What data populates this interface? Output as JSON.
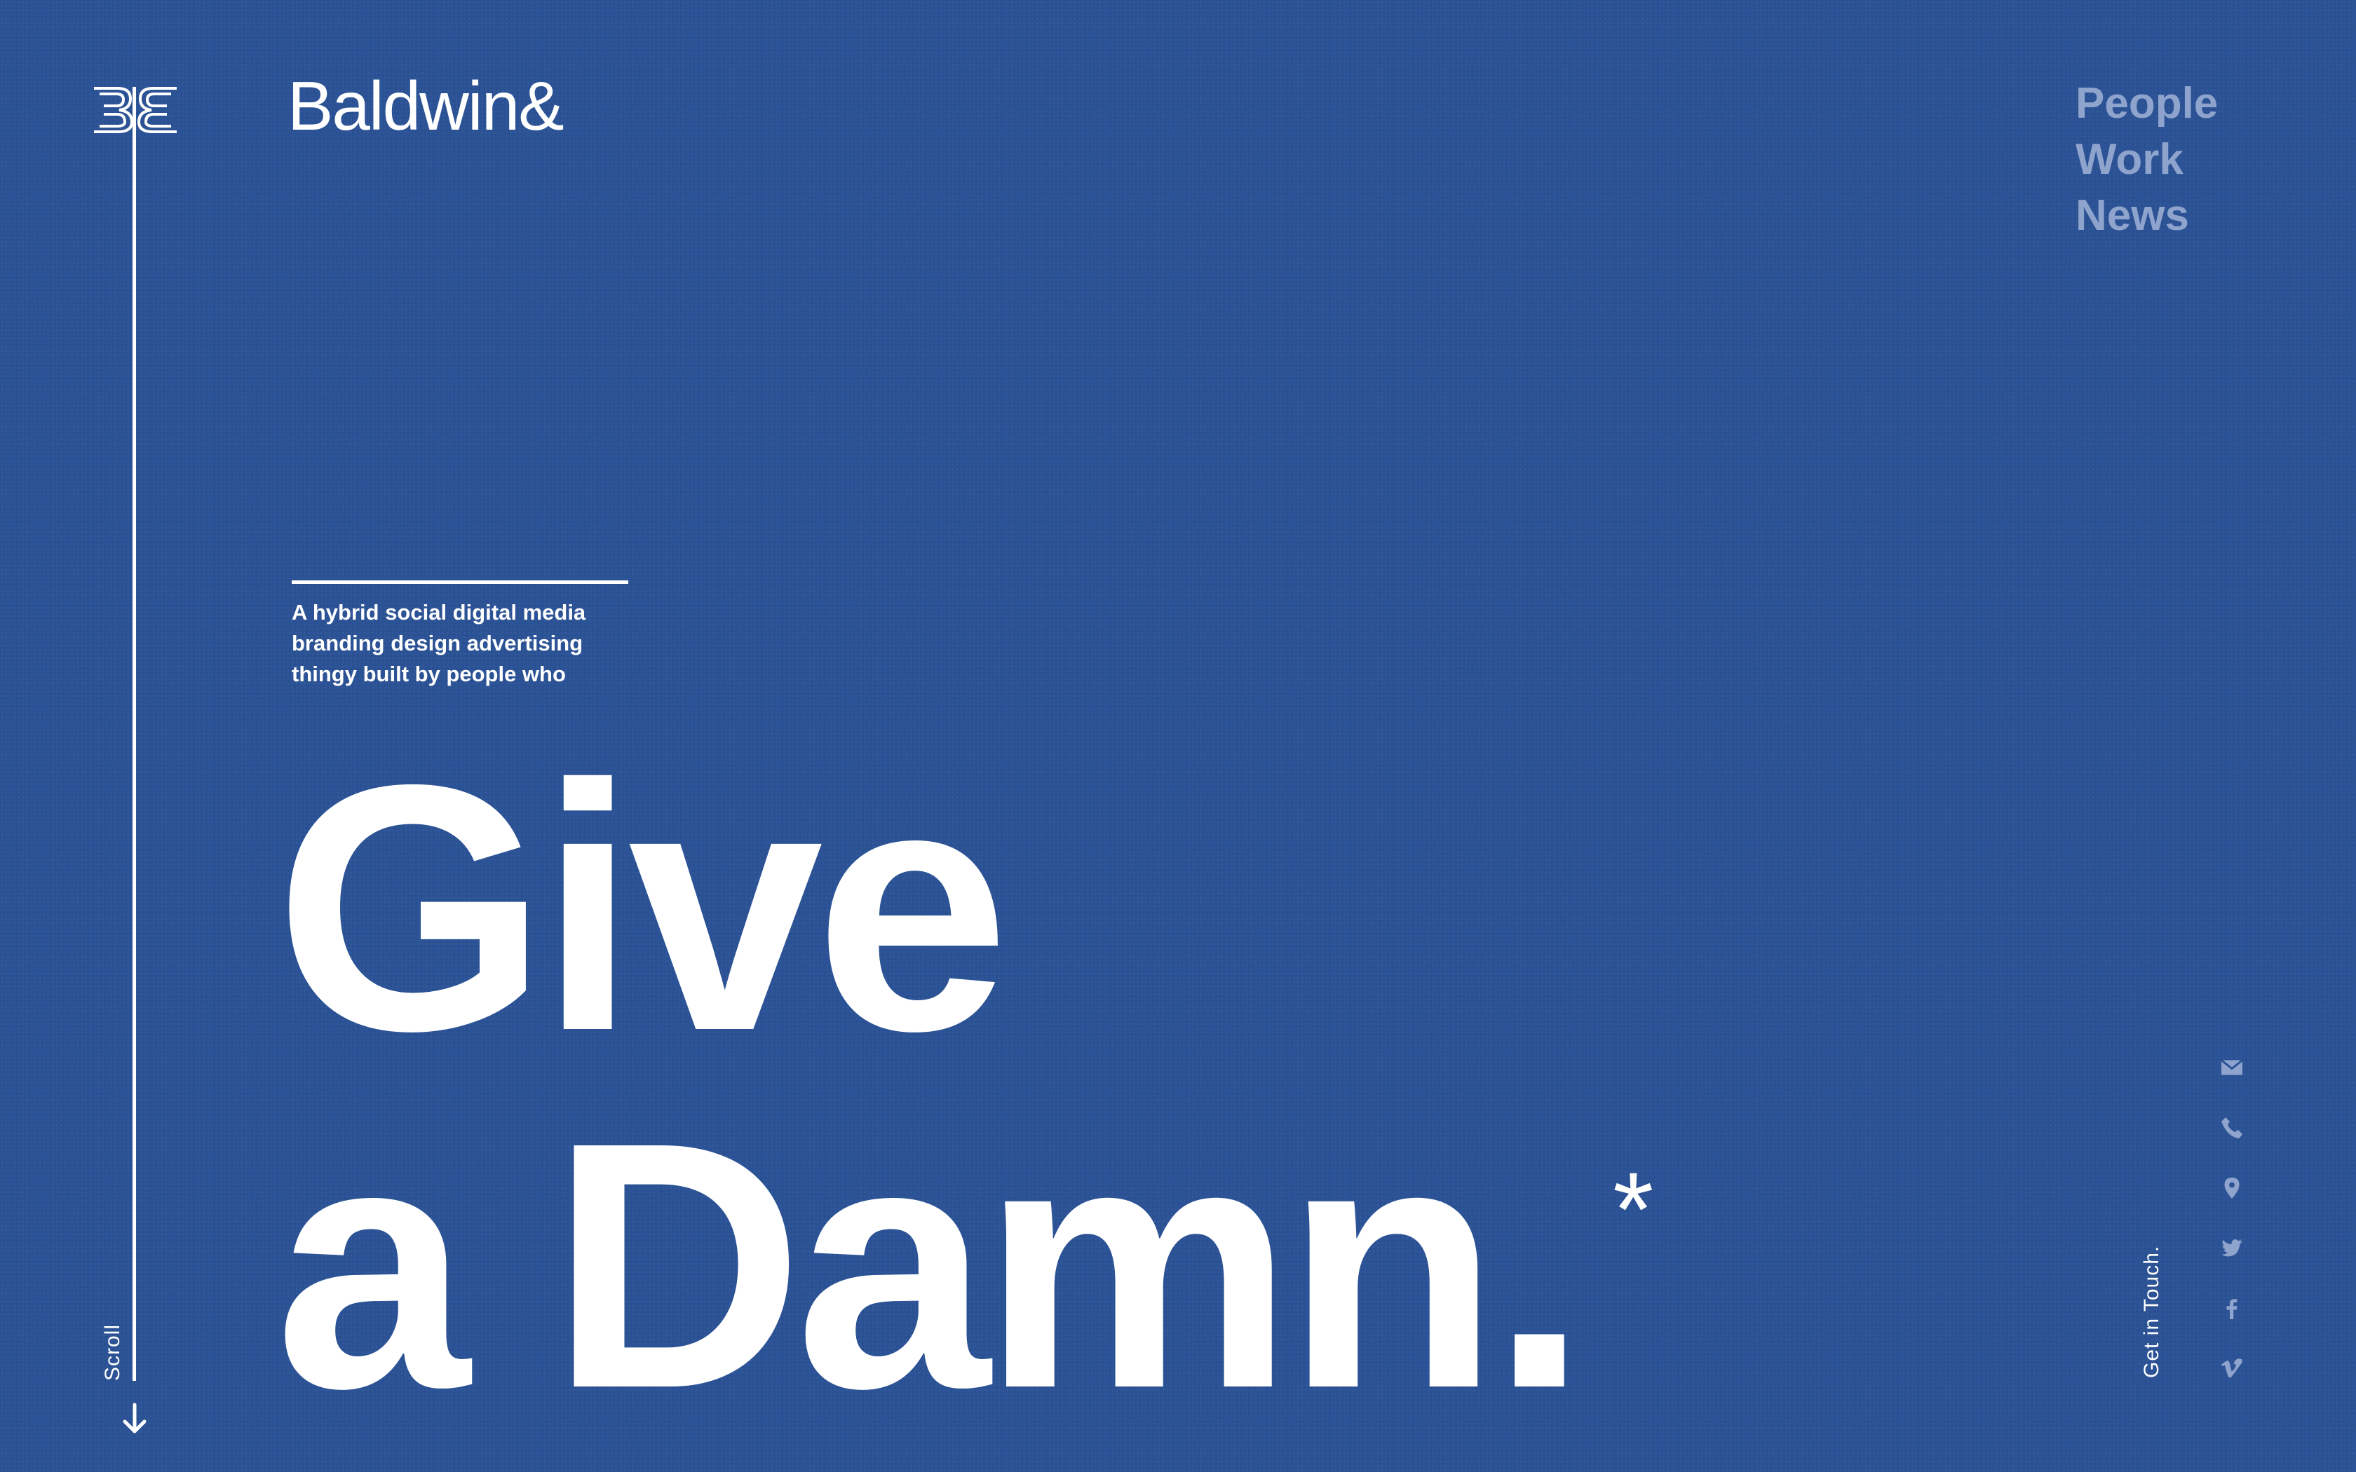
{
  "brand": {
    "monogram_icon": "bb-monogram-icon",
    "name": "Baldwin&"
  },
  "nav": {
    "items": [
      {
        "label": "People"
      },
      {
        "label": "Work"
      },
      {
        "label": "News"
      }
    ]
  },
  "intro": {
    "tagline_lines": [
      "A hybrid social digital media",
      "branding design advertising",
      "thingy built by people who"
    ]
  },
  "hero": {
    "line1": "Give",
    "line2": "a Damn.",
    "asterisk": "*"
  },
  "scroll": {
    "label": "Scroll",
    "icon": "arrow-down-icon"
  },
  "contact": {
    "label": "Get in Touch.",
    "icons": [
      "mail-icon",
      "phone-icon",
      "map-pin-icon",
      "twitter-icon",
      "facebook-icon",
      "vimeo-icon"
    ]
  },
  "colors": {
    "background": "#2b5295",
    "text": "#ffffff",
    "nav_text": "#8fa4cd",
    "icon_muted": "#8fa4cd"
  }
}
